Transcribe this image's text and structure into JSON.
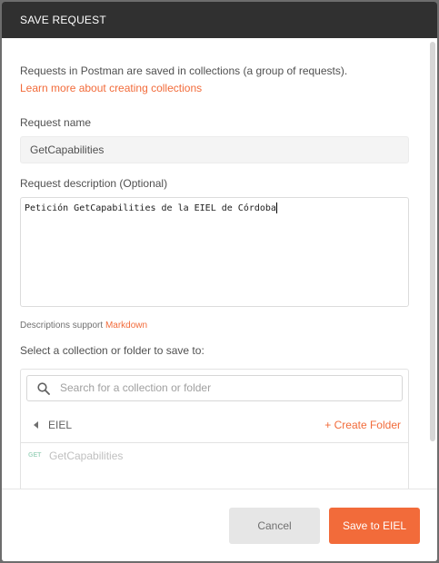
{
  "modal": {
    "title": "SAVE REQUEST"
  },
  "intro": {
    "text": "Requests in Postman are saved in collections (a group of requests).",
    "link": "Learn more about creating collections"
  },
  "request_name": {
    "label": "Request name",
    "value": "GetCapabilities"
  },
  "request_description": {
    "label": "Request description (Optional)",
    "value": "Petición GetCapabilities de la EIEL de Córdoba"
  },
  "description_support": {
    "text": "Descriptions support ",
    "link": "Markdown"
  },
  "collection_picker": {
    "label": "Select a collection or folder to save to:",
    "search_placeholder": "Search for a collection or folder",
    "current_folder": "EIEL",
    "create_folder": "+ Create Folder",
    "items": [
      {
        "method": "GET",
        "name": "GetCapabilities"
      }
    ]
  },
  "footer": {
    "cancel_label": "Cancel",
    "save_label": "Save to EIEL"
  },
  "colors": {
    "accent": "#f26b3a",
    "header_bg": "#303030",
    "get_method": "#a6d7c2"
  }
}
